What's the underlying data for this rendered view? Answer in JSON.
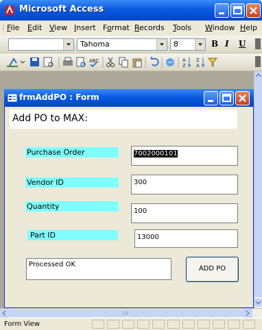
{
  "app": {
    "title": "Microsoft Access"
  },
  "menu": [
    {
      "label": "File",
      "ul": "F",
      "rest": "ile"
    },
    {
      "label": "Edit",
      "ul": "E",
      "rest": "dit"
    },
    {
      "label": "View",
      "ul": "V",
      "rest": "iew"
    },
    {
      "label": "Insert",
      "ul": "I",
      "rest": "nsert"
    },
    {
      "label": "Format",
      "pre": "F",
      "ul": "o",
      "rest": "rmat"
    },
    {
      "label": "Records",
      "ul": "R",
      "rest": "ecords"
    },
    {
      "label": "Tools",
      "ul": "T",
      "rest": "ools"
    },
    {
      "label": "Window",
      "ul": "W",
      "rest": "indow"
    },
    {
      "label": "Help",
      "ul": "H",
      "rest": "elp"
    }
  ],
  "formatting": {
    "object": "",
    "font": "Tahoma",
    "size": "8",
    "bold": "B",
    "italic": "I",
    "underline": "U"
  },
  "form": {
    "title": "frmAddPO : Form",
    "header": "Add PO to MAX:",
    "fields": [
      {
        "label": "Purchase Order",
        "value": "7002000101"
      },
      {
        "label": "Vendor ID",
        "value": "300"
      },
      {
        "label": "Quantity",
        "value": "100"
      },
      {
        "label": "Part ID",
        "value": "13000"
      }
    ],
    "status": "Processed OK",
    "button": "ADD PO"
  },
  "status_bar": {
    "text": "Form View"
  },
  "colors": {
    "titlebar": "#0a5ae0",
    "label_bg": "#80ffff",
    "workspace": "#aca899"
  }
}
